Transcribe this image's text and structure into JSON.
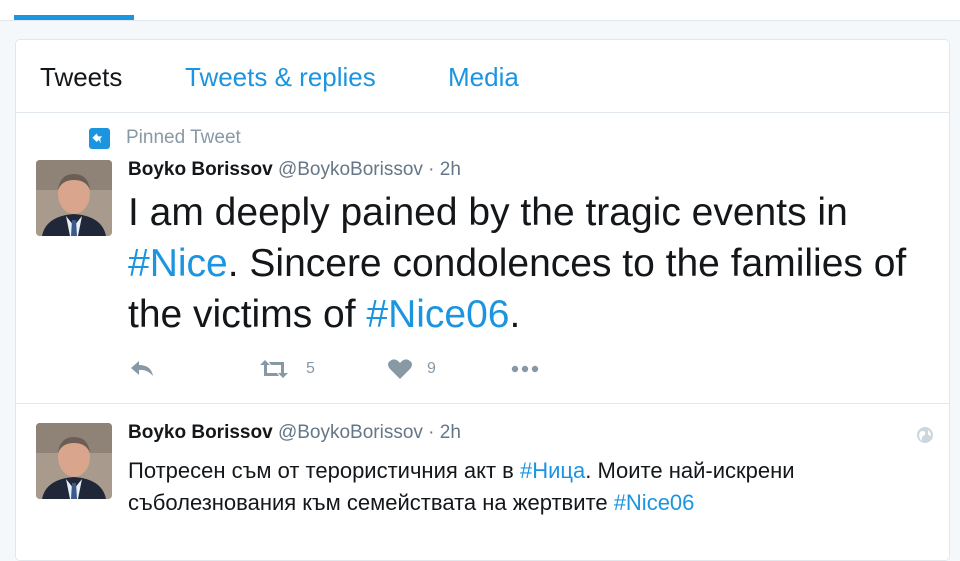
{
  "colors": {
    "accent": "#1b95e0",
    "text": "#14171a",
    "muted": "#8899a6",
    "border": "#e1e8ed"
  },
  "tabs": [
    {
      "label": "Tweets",
      "active": true
    },
    {
      "label": "Tweets & replies",
      "active": false
    },
    {
      "label": "Media",
      "active": false
    }
  ],
  "tweets": [
    {
      "pinned_label": "Pinned Tweet",
      "name": "Boyko Borissov",
      "handle": "@BoykoBorissov",
      "separator": "·",
      "time": "2h",
      "text": {
        "part1": "I am deeply pained by the tragic events in ",
        "hashtag1": "#Nice",
        "part2": ". Sincere condolences to the families of the victims of ",
        "hashtag2": "#Nice06",
        "part3": "."
      },
      "actions": {
        "reply_icon": "reply-icon",
        "retweet_icon": "retweet-icon",
        "retweets": "5",
        "like_icon": "heart-icon",
        "likes": "9",
        "more_icon": "more-icon"
      }
    },
    {
      "name": "Boyko Borissov",
      "handle": "@BoykoBorissov",
      "separator": "·",
      "time": "2h",
      "translate_icon": "globe-icon",
      "text": {
        "part1": "Потресен съм от терористичния акт в ",
        "hashtag1": "#Ница",
        "part2": ". Моите най-искрени съболезнования към семействата на жертвите ",
        "hashtag2": "#Nice06"
      }
    }
  ]
}
